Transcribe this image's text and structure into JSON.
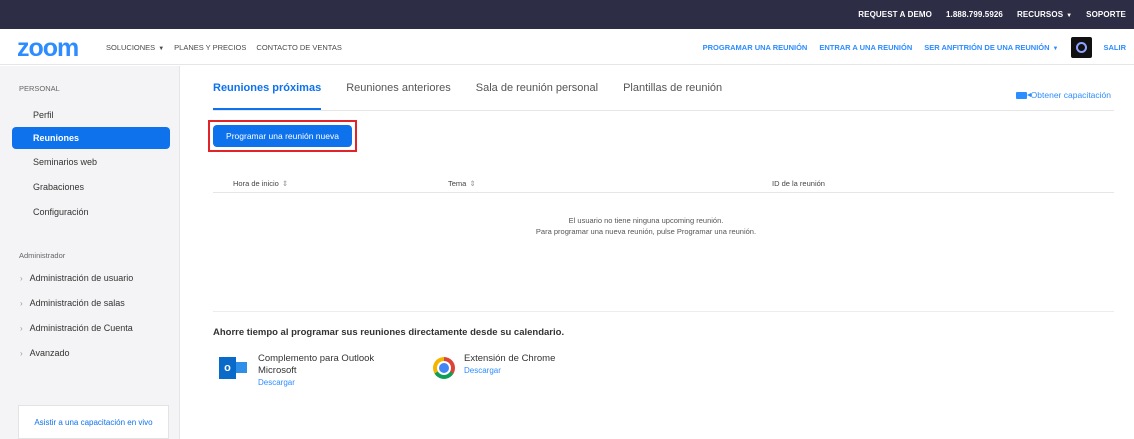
{
  "topbar": {
    "request_demo": "REQUEST A DEMO",
    "phone": "1.888.799.5926",
    "resources": "RECURSOS",
    "support": "SOPORTE"
  },
  "nav": {
    "logo": "zoom",
    "solutions": "SOLUCIONES",
    "plans": "PLANES Y PRECIOS",
    "contact_sales": "CONTACTO DE VENTAS",
    "schedule": "PROGRAMAR UNA REUNIÓN",
    "join": "ENTRAR A UNA REUNIÓN",
    "host": "SER ANFITRIÓN DE UNA REUNIÓN",
    "signout": "SALIR"
  },
  "sidebar": {
    "personal_label": "PERSONAL",
    "items": [
      {
        "label": "Perfil"
      },
      {
        "label": "Reuniones"
      },
      {
        "label": "Seminarios web"
      },
      {
        "label": "Grabaciones"
      },
      {
        "label": "Configuración"
      }
    ],
    "admin_label": "Administrador",
    "admin_items": [
      {
        "label": "Administración de usuario"
      },
      {
        "label": "Administración de salas"
      },
      {
        "label": "Administración de Cuenta"
      },
      {
        "label": "Avanzado"
      }
    ],
    "live_training": "Asistir a una capacitación en vivo"
  },
  "main": {
    "tabs": [
      {
        "label": "Reuniones próximas"
      },
      {
        "label": "Reuniones anteriores"
      },
      {
        "label": "Sala de reunión personal"
      },
      {
        "label": "Plantillas de reunión"
      }
    ],
    "training_link": "Obtener capacitación",
    "schedule_button": "Programar una reunión nueva",
    "table": {
      "headers": [
        "Hora de inicio",
        "Tema",
        "ID de la reunión"
      ],
      "sort_glyph": "⇕"
    },
    "empty_line1": "El usuario no tiene ninguna upcoming reunión.",
    "empty_line2": "Para programar una nueva reunión, pulse Programar una reunión.",
    "calendar_title": "Ahorre tiempo al programar sus reuniones directamente desde su calendario.",
    "addons": [
      {
        "name_line1": "Complemento para Outlook",
        "name_line2": "Microsoft",
        "link": "Descargar",
        "icon": "outlook-icon"
      },
      {
        "name_line1": "Extensión de Chrome",
        "link": "Descargar",
        "icon": "chrome-icon"
      }
    ]
  },
  "colors": {
    "accent": "#0e72ed",
    "link": "#2d8cff",
    "topbar": "#2d2d45",
    "highlight": "#e0242a"
  }
}
